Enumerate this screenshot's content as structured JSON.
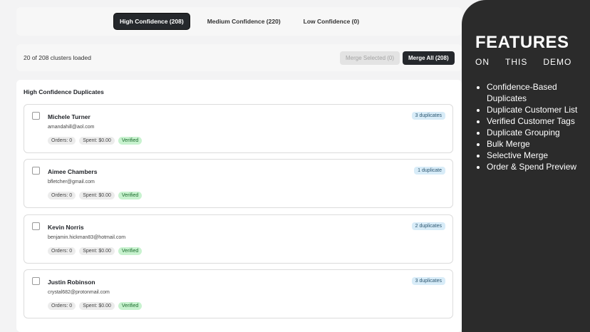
{
  "tabs": [
    {
      "label": "High Confidence (208)",
      "active": true
    },
    {
      "label": "Medium Confidence (220)",
      "active": false
    },
    {
      "label": "Low Confidence (0)",
      "active": false
    }
  ],
  "toolbar": {
    "loaded_text": "20 of 208 clusters loaded",
    "merge_selected_label": "Merge Selected (0)",
    "merge_all_label": "Merge All (208)"
  },
  "panel": {
    "title": "High Confidence Duplicates"
  },
  "cards": [
    {
      "name": "Michele Turner",
      "email": "amandahill@aol.com",
      "orders": "Orders: 0",
      "spent": "Spent: $0.00",
      "status": "Verified",
      "duplicates": "3 duplicates"
    },
    {
      "name": "Aimee Chambers",
      "email": "bfletcher@gmail.com",
      "orders": "Orders: 0",
      "spent": "Spent: $0.00",
      "status": "Verified",
      "duplicates": "1 duplicate"
    },
    {
      "name": "Kevin Norris",
      "email": "benjamin.hickman83@hotmail.com",
      "orders": "Orders: 0",
      "spent": "Spent: $0.00",
      "status": "Verified",
      "duplicates": "2 duplicates"
    },
    {
      "name": "Justin Robinson",
      "email": "crystal682@protonmail.com",
      "orders": "Orders: 0",
      "spent": "Spent: $0.00",
      "status": "Verified",
      "duplicates": "3 duplicates"
    }
  ],
  "features": {
    "title": "FEATURES",
    "subtitle_words": [
      "ON",
      "THIS",
      "DEMO"
    ],
    "items": [
      "Confidence-Based Duplicates",
      "Duplicate Customer List",
      "Verified Customer Tags",
      "Duplicate Grouping",
      "Bulk Merge",
      "Selective Merge",
      "Order & Spend Preview"
    ]
  },
  "colors": {
    "accent_dark": "#25282c",
    "verified_bg": "#c8f2cf",
    "duplicate_badge_bg": "#d8ecf8",
    "feature_panel_bg": "#2b2b2b"
  }
}
